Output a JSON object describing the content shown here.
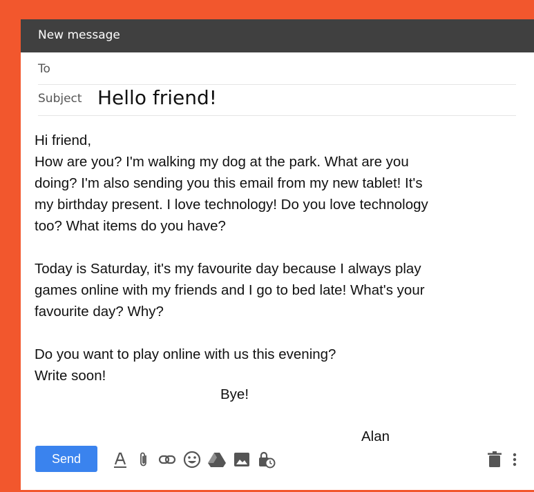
{
  "window": {
    "title": "New message"
  },
  "fields": {
    "to_label": "To",
    "to_value": "",
    "subject_label": "Subject",
    "subject_value": "Hello friend!"
  },
  "body": {
    "paragraph_1_lines": [
      "Hi friend,",
      "How are you? I'm walking my dog at the park. What are you",
      "doing? I'm also sending you this email from my new tablet! It's",
      "my birthday present. I love technology! Do you love technology",
      "too? What items do you have?"
    ],
    "paragraph_2_lines": [
      "Today is Saturday, it's my favourite day because I always play",
      "games online with my friends and I go to bed late! What's your",
      "favourite day? Why?"
    ],
    "paragraph_3_lines": [
      "Do you want to play online with us this evening?",
      "Write soon!"
    ],
    "closing": "Bye!",
    "signature": "Alan"
  },
  "toolbar": {
    "send_label": "Send",
    "icons": [
      "text-format-icon",
      "attach-icon",
      "link-icon",
      "emoji-icon",
      "drive-icon",
      "image-icon",
      "confidential-icon",
      "trash-icon",
      "more-options-icon"
    ]
  },
  "colors": {
    "frame": "#f2572d",
    "titlebar": "#404040",
    "send_button": "#3a83ee",
    "icons": "#555555"
  }
}
